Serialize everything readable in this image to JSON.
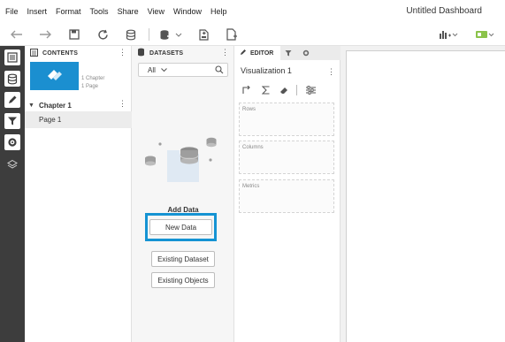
{
  "menu": [
    "File",
    "Insert",
    "Format",
    "Tools",
    "Share",
    "View",
    "Window",
    "Help"
  ],
  "document_title": "Untitled Dashboard",
  "toolbar": {
    "icons": [
      "undo-icon",
      "redo-icon",
      "save-icon",
      "refresh-icon",
      "data-source-icon",
      "add-dataset-icon",
      "add-chapter-icon",
      "add-page-icon",
      "visualization-picker-icon",
      "filter-toggle-icon"
    ],
    "accent": "#8bc34a"
  },
  "rail": {
    "icons": [
      "contents-icon",
      "datasets-icon",
      "editor-icon",
      "filter-icon",
      "format-icon",
      "layers-icon"
    ],
    "active_index": 0
  },
  "contents": {
    "header": "CONTENTS",
    "thumbnail_meta": [
      "1 Chapter",
      "1 Page"
    ],
    "chapter": "Chapter 1",
    "page": "Page 1",
    "thumb_color": "#1b8fd0"
  },
  "datasets": {
    "header": "DATASETS",
    "filter_value": "All",
    "add_data_label": "Add Data",
    "new_data_button": "New Data",
    "existing_dataset_button": "Existing Dataset",
    "existing_objects_button": "Existing Objects",
    "highlight_color": "#1593d3"
  },
  "editor": {
    "header": "EDITOR",
    "visualization_title": "Visualization 1",
    "zones": [
      "Rows",
      "Columns",
      "Metrics"
    ]
  }
}
